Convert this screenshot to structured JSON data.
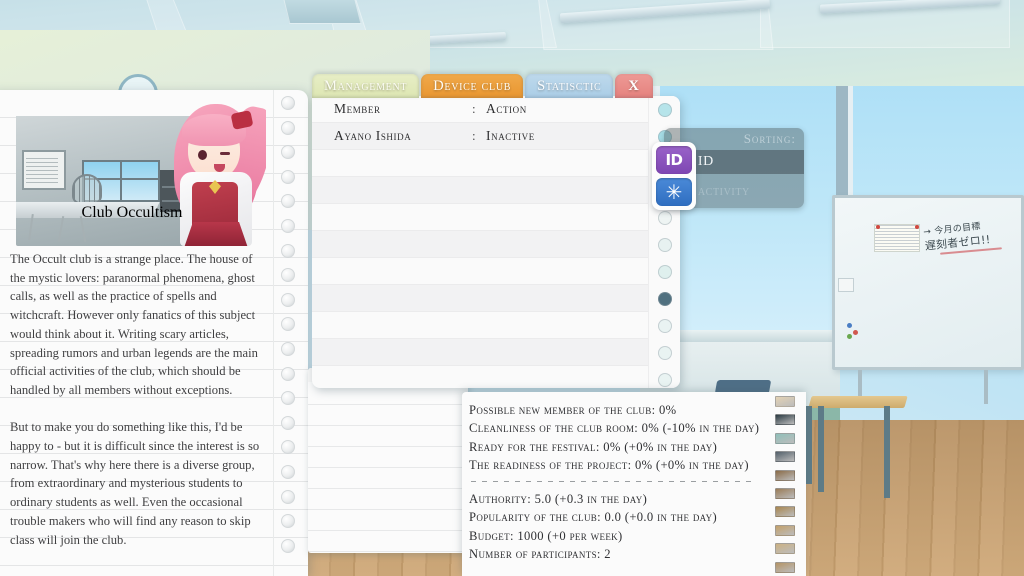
{
  "window": {
    "tabs": [
      {
        "id": "management",
        "label": "Management",
        "active": false
      },
      {
        "id": "device",
        "label": "Device club",
        "active": true
      },
      {
        "id": "statistic",
        "label": "Statisctic",
        "active": false
      }
    ],
    "close_label": "X"
  },
  "member_table": {
    "header": {
      "name": "Member",
      "colon": ":",
      "action": "Action"
    },
    "rows": [
      {
        "name": "Ayano Ishida",
        "colon": ":",
        "action": "Inactive"
      }
    ],
    "dot_colors": [
      "#b6e4ea",
      "#a7dfe8",
      "#eef4f3",
      "#eef4f3",
      "#eef4f3",
      "#e7f2f1",
      "#dff0ee",
      "#50707f",
      "#e9f3f2",
      "#e9f3f2",
      "#e9f3f2",
      "#7d7354",
      "#6f9a96",
      "#41617f"
    ]
  },
  "sorting": {
    "title": "Sorting:",
    "options": [
      {
        "label": "By ID",
        "selected": true
      },
      {
        "label": "By activity",
        "selected": false
      }
    ],
    "buttons": [
      {
        "id": "sort-by-id",
        "glyph": "ID",
        "color": "#8552bb"
      },
      {
        "id": "sort-by-activity",
        "glyph": "✳",
        "color": "#3a77c9"
      }
    ]
  },
  "club_card": {
    "title_small": "Club",
    "title_large": "Occultism",
    "paragraphs": [
      "The Occult club is a strange place. The house of the mystic lovers: paranormal phenomena, ghost calls, as well as the practice of spells and witchcraft. However only fanatics of this subject would think about it. Writing scary articles, spreading rumors and urban legends are the main official activities of the club, which should be handled by all members without exceptions.",
      "But to make you do something like this, I'd be happy to - but it is difficult since the interest is so narrow. That's why here there is a diverse group, from extraordinary and mysterious students to ordinary students as well. Even the occasional trouble makers who will find any reason to skip class will join the club."
    ]
  },
  "stats": {
    "group_a": [
      "Possible new member of the club: 0%",
      "Cleanliness of the club room: 0% (-10% in the day)",
      "Ready for the festival: 0% (+0% in the day)",
      "The readiness of the project: 0% (+0% in the day)"
    ],
    "group_b": [
      "Authority: 5.0 (+0.3 in the day)",
      "Popularity of the club: 0.0 (+0.0 in the day)",
      "Budget: 1000 (+0 per week)",
      "Number of participants: 2"
    ],
    "thumb_colors": [
      "#e4d2b4",
      "#2a3a42",
      "#8fbfb9",
      "#53606a",
      "#8a6b47",
      "#9a7c57",
      "#a8864f",
      "#c2a06a",
      "#cbb183",
      "#b49466"
    ]
  },
  "background": {
    "whiteboard_text_line1": "→ 今月の目標",
    "whiteboard_text_line2": "遅刻者ゼロ!!"
  }
}
